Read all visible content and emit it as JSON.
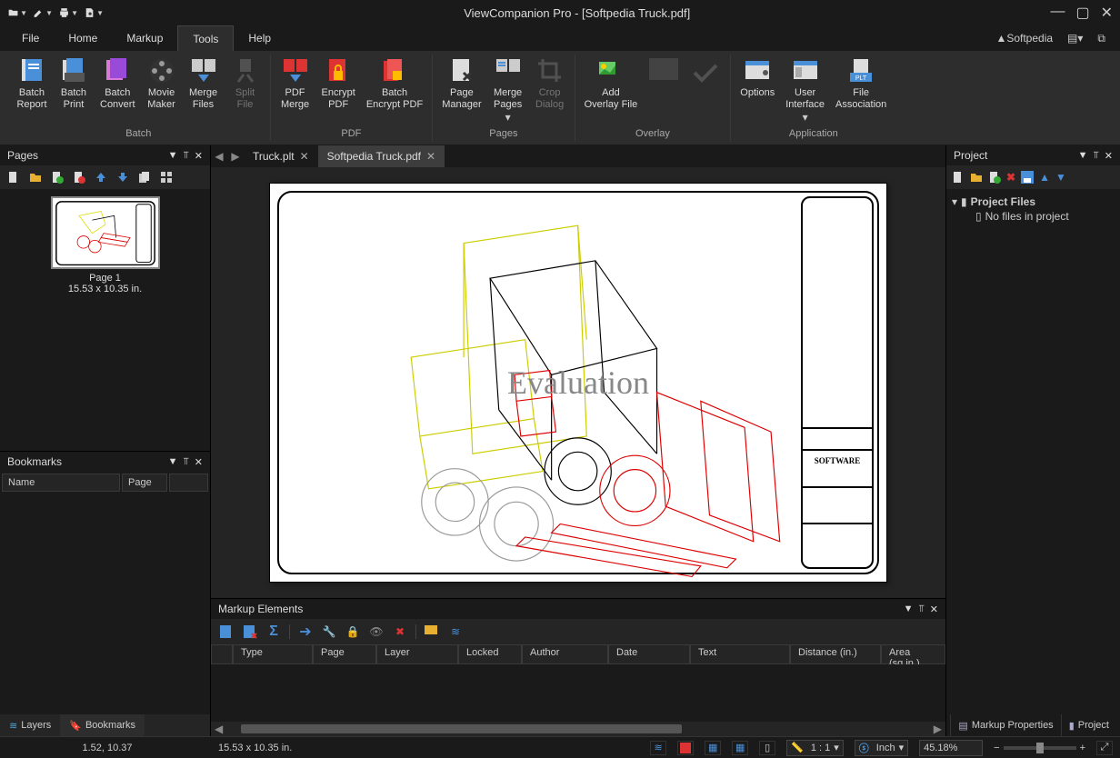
{
  "title": "ViewCompanion Pro - [Softpedia Truck.pdf]",
  "menu": {
    "file": "File",
    "home": "Home",
    "markup": "Markup",
    "tools": "Tools",
    "help": "Help"
  },
  "top_right": {
    "brand": "Softpedia"
  },
  "ribbon": {
    "batch": {
      "label": "Batch",
      "report": "Batch\nReport",
      "print": "Batch\nPrint",
      "convert": "Batch\nConvert",
      "movie": "Movie\nMaker",
      "merge": "Merge\nFiles",
      "split": "Split\nFile"
    },
    "pdf": {
      "label": "PDF",
      "merge": "PDF\nMerge",
      "encrypt": "Encrypt\nPDF",
      "batchenc": "Batch\nEncrypt PDF"
    },
    "pages": {
      "label": "Pages",
      "manager": "Page\nManager",
      "mergepages": "Merge\nPages",
      "crop": "Crop\nDialog"
    },
    "overlay": {
      "label": "Overlay",
      "add": "Add\nOverlay File"
    },
    "application": {
      "label": "Application",
      "options": "Options",
      "ui": "User\nInterface",
      "fileassoc": "File\nAssociation"
    }
  },
  "pages_panel": {
    "title": "Pages",
    "thumb_title": "Page 1",
    "thumb_dim": "15.53 x 10.35 in."
  },
  "bookmarks_panel": {
    "title": "Bookmarks",
    "col_name": "Name",
    "col_page": "Page"
  },
  "left_tabs": {
    "layers": "Layers",
    "bookmarks": "Bookmarks"
  },
  "doc_tabs": {
    "tab1": "Truck.plt",
    "tab2": "Softpedia Truck.pdf"
  },
  "watermark": "Evaluation",
  "titleblock_text": "SOFTWARE",
  "markup_panel": {
    "title": "Markup Elements",
    "cols": {
      "type": "Type",
      "page": "Page",
      "layer": "Layer",
      "locked": "Locked",
      "author": "Author",
      "date": "Date",
      "text": "Text",
      "distance": "Distance (in.)",
      "area": "Area (sq.in.)"
    }
  },
  "project_panel": {
    "title": "Project",
    "root": "Project Files",
    "empty": "No files in project"
  },
  "footer_tabs": {
    "markup_props": "Markup Properties",
    "project": "Project"
  },
  "status": {
    "coords": "1.52, 10.37",
    "dim": "15.53 x 10.35 in.",
    "scale": "1 : 1",
    "unit": "Inch",
    "zoom": "45.18%",
    "zoom_alt": "45.18%"
  }
}
